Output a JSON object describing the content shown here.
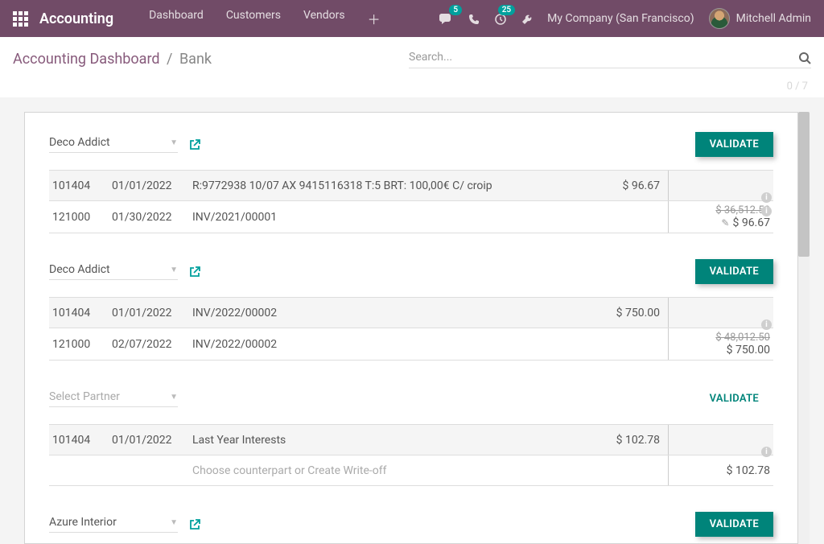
{
  "topnav": {
    "brand": "Accounting",
    "links": [
      "Dashboard",
      "Customers",
      "Vendors"
    ],
    "chat_badge": "5",
    "clock_badge": "25",
    "company": "My Company (San Francisco)",
    "username": "Mitchell Admin"
  },
  "breadcrumb": {
    "root": "Accounting Dashboard",
    "sep": "/",
    "current": "Bank"
  },
  "search_placeholder": "Search...",
  "counter": "0 / 7",
  "validate_label": "VALIDATE",
  "blocks": [
    {
      "partner": "Deco Addict",
      "has_partner": true,
      "has_ext": true,
      "validate_style": "solid",
      "rows": [
        {
          "a": "101404",
          "b": "01/01/2022",
          "c": "R:9772938 10/07 AX 9415116318 T:5 BRT: 100,00€ C/ croip",
          "d": "$ 96.67",
          "e_strike": "",
          "e_val": "",
          "info": true,
          "highlight": true
        },
        {
          "a": "121000",
          "b": "01/30/2022",
          "c": "INV/2021/00001",
          "d": "",
          "e_strike": "$ 36,512.50",
          "e_val": "$ 96.67",
          "info": true,
          "pencil": true
        }
      ]
    },
    {
      "partner": "Deco Addict",
      "has_partner": true,
      "has_ext": true,
      "validate_style": "solid",
      "rows": [
        {
          "a": "101404",
          "b": "01/01/2022",
          "c": "INV/2022/00002",
          "d": "$ 750.00",
          "e_strike": "",
          "e_val": "",
          "info": true,
          "highlight": true
        },
        {
          "a": "121000",
          "b": "02/07/2022",
          "c": "INV/2022/00002",
          "d": "",
          "e_strike": "$ 48,012.50",
          "e_val": "$ 750.00",
          "info": false
        }
      ]
    },
    {
      "partner": "Select Partner",
      "has_partner": false,
      "has_ext": false,
      "validate_style": "ghost",
      "rows": [
        {
          "a": "101404",
          "b": "01/01/2022",
          "c": "Last Year Interests",
          "d": "$ 102.78",
          "e_strike": "",
          "e_val": "",
          "info": true,
          "highlight": true
        },
        {
          "a": "",
          "b": "",
          "c": "Choose counterpart or Create Write-off",
          "c_placeholder": true,
          "d": "",
          "e_strike": "",
          "e_val": "$ 102.78",
          "info": false
        }
      ]
    },
    {
      "partner": "Azure Interior",
      "has_partner": true,
      "has_ext": true,
      "validate_style": "solid",
      "rows": []
    }
  ]
}
